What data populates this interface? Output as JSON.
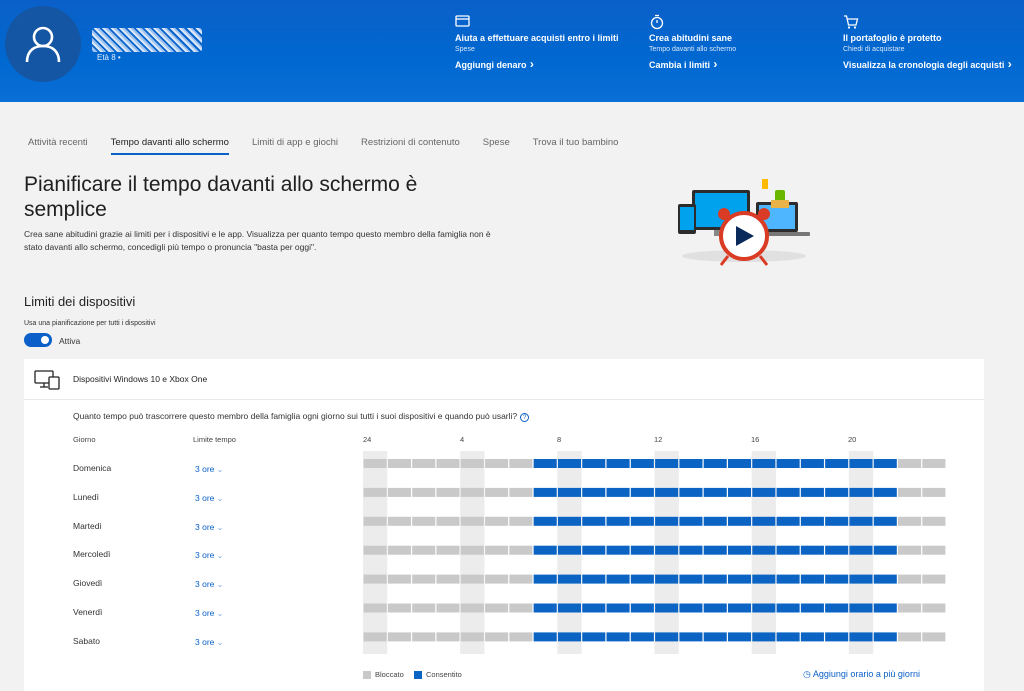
{
  "header": {
    "user": {
      "age": "Età 8 •"
    },
    "cards": [
      {
        "icon": "card-icon",
        "title": "Aiuta             a effettuare acquisti entro i limiti",
        "sub": "Spese",
        "link": "Aggiungi denaro"
      },
      {
        "icon": "stopwatch-icon",
        "title": "Crea abitudini sane",
        "sub": "Tempo davanti allo schermo",
        "link": "Cambia i limiti"
      },
      {
        "icon": "cart-icon",
        "title": "Il portafoglio è protetto",
        "sub": "Chiedi di acquistare",
        "link": "Visualizza la cronologia degli acquisti"
      }
    ]
  },
  "tabs": [
    "Attività recenti",
    "Tempo davanti allo schermo",
    "Limiti di app e giochi",
    "Restrizioni di contenuto",
    "Spese",
    "Trova il tuo bambino"
  ],
  "active_tab": 1,
  "hero": {
    "title": "Pianificare il tempo davanti allo schermo è semplice",
    "description": "Crea sane abitudini grazie ai limiti per i dispositivi e le app. Visualizza per quanto tempo questo membro della famiglia non è stato davanti allo schermo, concedigli più tempo o pronuncia \"basta per oggi\"."
  },
  "device_limits": {
    "title": "Limiti dei dispositivi",
    "schedule_label": "Usa una pianificazione per tutti i dispositivi",
    "toggle_label": "Attiva",
    "toggle_on": true
  },
  "devices_card": {
    "title": "Dispositivi Windows 10 e Xbox One",
    "question": "Quanto tempo può trascorrere questo membro della famiglia ogni giorno sui tutti i suoi dispositivi e quando può usarli?",
    "col_day": "Giorno",
    "col_limit": "Limite tempo",
    "hour_labels": [
      "24",
      "4",
      "8",
      "12",
      "16",
      "20"
    ],
    "rows": [
      {
        "day": "Domenica",
        "limit": "3 ore"
      },
      {
        "day": "Lunedì",
        "limit": "3 ore"
      },
      {
        "day": "Martedì",
        "limit": "3 ore"
      },
      {
        "day": "Mercoledì",
        "limit": "3 ore"
      },
      {
        "day": "Giovedì",
        "limit": "3 ore"
      },
      {
        "day": "Venerdì",
        "limit": "3 ore"
      },
      {
        "day": "Sabato",
        "limit": "3 ore"
      }
    ],
    "schedule": {
      "allowed_from_hour": 7,
      "allowed_to_hour": 22
    },
    "legend": {
      "blocked": "Bloccato",
      "allowed": "Consentito"
    },
    "add_link": "Aggiungi orario a più giorni"
  },
  "colors": {
    "allowed": "#0b63c4",
    "blocked": "#c9c9c9",
    "accent": "#0a60c8"
  }
}
